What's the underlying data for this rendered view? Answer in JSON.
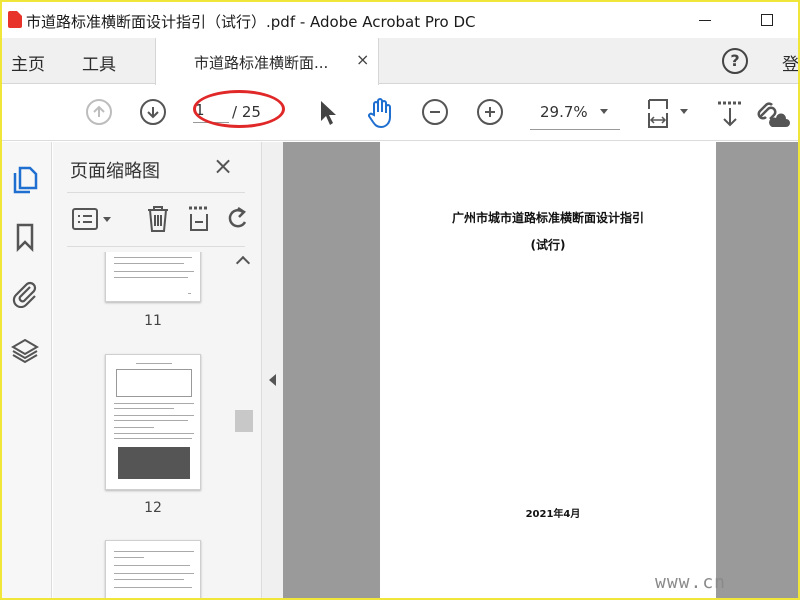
{
  "window": {
    "title": "市道路标准横断面设计指引（试行）.pdf - Adobe Acrobat Pro DC"
  },
  "tabbar": {
    "home": "主页",
    "tools": "工具",
    "doc_tab": "市道路标准横断面...",
    "close_glyph": "×",
    "help_glyph": "?",
    "signin": "登"
  },
  "toolbar": {
    "current_page": "1",
    "total_pages": "/ 25",
    "zoom": "29.7%"
  },
  "thumbnails": {
    "title": "页面缩略图",
    "close_glyph": "×",
    "pages": [
      {
        "label": "11"
      },
      {
        "label": "12"
      },
      {
        "label": ""
      }
    ]
  },
  "document": {
    "title": "广州市城市道路标准横断面设计指引",
    "subtitle": "(试行)",
    "date": "2021年4月"
  },
  "watermark": "www.cn",
  "colors": {
    "frame": "#f0e63a",
    "annotation": "#e12828",
    "canvas": "#9a9a9a"
  }
}
